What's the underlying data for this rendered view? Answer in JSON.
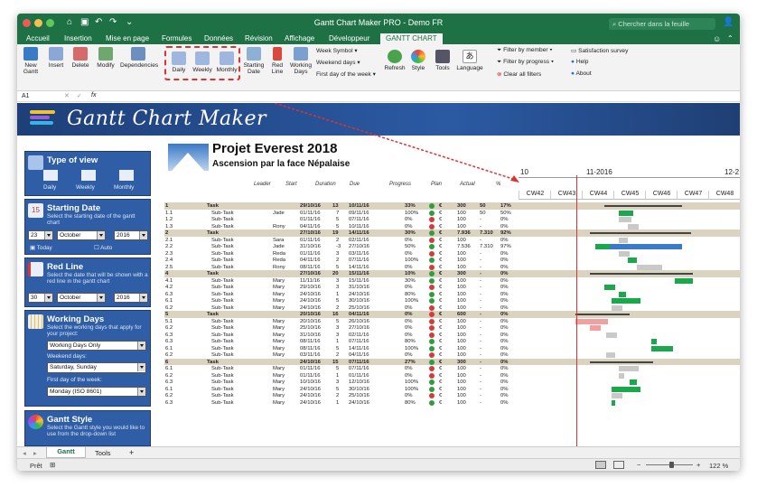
{
  "window": {
    "title": "Gantt Chart Maker PRO - Demo FR",
    "search_placeholder": "Chercher dans la feuille",
    "user_icon": "add-user-icon"
  },
  "menu": [
    "Accueil",
    "Insertion",
    "Mise en page",
    "Formules",
    "Données",
    "Révision",
    "Affichage",
    "Développeur",
    "GANTT CHART"
  ],
  "ribbon": {
    "new_gantt": "New\nGantt",
    "insert": "Insert",
    "delete": "Delete",
    "modify": "Modify",
    "dependencies": "Dependencies",
    "daily": "Daily",
    "weekly": "Weekly",
    "monthly": "Monthly",
    "starting_date": "Starting\nDate",
    "red_line": "Red\nLine",
    "working_days": "Working\nDays",
    "week_symbol": "Week Symbol",
    "weekend_days": "Weekend days",
    "first_day": "First day of the week",
    "refresh": "Refresh",
    "style": "Style",
    "tools": "Tools",
    "language": "Language",
    "filter_member": "Filter by member",
    "filter_progress": "Filter by progress",
    "clear_filters": "Clear all filters",
    "satisfaction": "Satisfaction survey",
    "help": "Help",
    "about": "About"
  },
  "formula": {
    "cell": "A1",
    "fx": "fx"
  },
  "banner": {
    "text": "Gantt Chart Maker"
  },
  "side": {
    "type_title": "Type of view",
    "daily": "Daily",
    "weekly": "Weekly",
    "monthly": "Monthly",
    "start_title": "Starting Date",
    "start_desc": "Select the starting date of the gantt chart",
    "start_day": "23",
    "start_month": "October",
    "start_year": "2016",
    "today": "Today",
    "auto": "Auto",
    "red_title": "Red Line",
    "red_desc": "Select the date that will be shown with a red line in the gantt chart",
    "red_day": "30",
    "red_month": "October",
    "red_year": "2016",
    "work_title": "Working Days",
    "work_desc": "Select the working days that apply for your project:",
    "work_sel": "Working Days Only",
    "weekend_lab": "Weekend days:",
    "weekend_sel": "Saturday, Sunday",
    "first_lab": "First day of the week:",
    "first_sel": "Monday (ISO 8601)",
    "style_title": "Gantt Style",
    "style_desc": "Select the Gantt style you would like to use from the drop-down list"
  },
  "project": {
    "title": "Projet Everest 2018",
    "subtitle": "Ascension par la face Népalaise"
  },
  "columns": [
    "Leader",
    "Start",
    "Duration",
    "Due",
    "Progress",
    "Plan",
    "Actual",
    "%"
  ],
  "timeline": {
    "months": [
      "10",
      "11-2016",
      "12-2"
    ],
    "weeks": [
      "CW42",
      "CW43",
      "CW44",
      "CW45",
      "CW46",
      "CW47",
      "CW48"
    ]
  },
  "rows": [
    {
      "id": "1",
      "name": "Task",
      "leader": "",
      "start": "29/10/16",
      "dur": "13",
      "due": "10/11/16",
      "prog": "33%",
      "dot": "#2e9e3c",
      "plan": "300",
      "actual": "50",
      "pct": "17%",
      "t": 1
    },
    {
      "id": "1.1",
      "name": "Sub-Task",
      "leader": "Jade",
      "start": "01/11/16",
      "dur": "7",
      "due": "09/11/16",
      "prog": "100%",
      "dot": "#2e9e3c",
      "plan": "100",
      "actual": "50",
      "pct": "50%"
    },
    {
      "id": "1.2",
      "name": "Sub-Task",
      "leader": "",
      "start": "01/11/16",
      "dur": "5",
      "due": "07/11/16",
      "prog": "0%",
      "dot": "#d23c3c",
      "plan": "100",
      "actual": "-",
      "pct": "0%"
    },
    {
      "id": "1.3",
      "name": "Sub-Task",
      "leader": "Rony",
      "start": "04/11/16",
      "dur": "5",
      "due": "10/11/16",
      "prog": "0%",
      "dot": "#d23c3c",
      "plan": "100",
      "actual": "-",
      "pct": "0%"
    },
    {
      "id": "2",
      "name": "Task",
      "leader": "",
      "start": "27/10/16",
      "dur": "19",
      "due": "14/11/16",
      "prog": "30%",
      "dot": "#2e9e3c",
      "plan": "7.936",
      "actual": "7.310",
      "pct": "92%",
      "t": 1
    },
    {
      "id": "2.1",
      "name": "Sub-Task",
      "leader": "Sara",
      "start": "01/11/16",
      "dur": "2",
      "due": "02/11/16",
      "prog": "0%",
      "dot": "#d23c3c",
      "plan": "100",
      "actual": "-",
      "pct": "0%"
    },
    {
      "id": "2.2",
      "name": "Sub-Task",
      "leader": "Jade",
      "start": "31/10/16",
      "dur": "-3",
      "due": "27/10/16",
      "prog": "50%",
      "dot": "#2e9e3c",
      "plan": "7.536",
      "actual": "7.310",
      "pct": "97%"
    },
    {
      "id": "2.3",
      "name": "Sub-Task",
      "leader": "Reda",
      "start": "01/11/16",
      "dur": "3",
      "due": "03/11/16",
      "prog": "0%",
      "dot": "#d23c3c",
      "plan": "100",
      "actual": "-",
      "pct": "0%"
    },
    {
      "id": "2.4",
      "name": "Sub-Task",
      "leader": "Reda",
      "start": "04/11/16",
      "dur": "2",
      "due": "07/11/16",
      "prog": "100%",
      "dot": "#2e9e3c",
      "plan": "100",
      "actual": "-",
      "pct": "0%"
    },
    {
      "id": "2.5",
      "name": "Sub-Task",
      "leader": "Rony",
      "start": "08/11/16",
      "dur": "5",
      "due": "14/11/16",
      "prog": "0%",
      "dot": "#d23c3c",
      "plan": "100",
      "actual": "-",
      "pct": "0%"
    },
    {
      "id": "4",
      "name": "Task",
      "leader": "",
      "start": "27/10/16",
      "dur": "20",
      "due": "15/11/16",
      "prog": "10%",
      "dot": "#2e9e3c",
      "plan": "300",
      "actual": "-",
      "pct": "0%",
      "t": 1
    },
    {
      "id": "4.1",
      "name": "Sub-Task",
      "leader": "Mary",
      "start": "11/11/16",
      "dur": "3",
      "due": "15/11/16",
      "prog": "30%",
      "dot": "#2e9e3c",
      "plan": "100",
      "actual": "-",
      "pct": "0%"
    },
    {
      "id": "4.2",
      "name": "Sub-Task",
      "leader": "Mary",
      "start": "29/10/16",
      "dur": "3",
      "due": "31/10/16",
      "prog": "0%",
      "dot": "#d23c3c",
      "plan": "100",
      "actual": "-",
      "pct": "0%"
    },
    {
      "id": "6.3",
      "name": "Sub-Task",
      "leader": "Mary",
      "start": "24/10/16",
      "dur": "1",
      "due": "24/10/16",
      "prog": "80%",
      "dot": "#2e9e3c",
      "plan": "100",
      "actual": "-",
      "pct": "0%"
    },
    {
      "id": "6.1",
      "name": "Sub-Task",
      "leader": "Mary",
      "start": "24/10/16",
      "dur": "5",
      "due": "30/10/16",
      "prog": "100%",
      "dot": "#2e9e3c",
      "plan": "100",
      "actual": "-",
      "pct": "0%"
    },
    {
      "id": "6.2",
      "name": "Sub-Task",
      "leader": "Mary",
      "start": "24/10/16",
      "dur": "2",
      "due": "25/10/16",
      "prog": "0%",
      "dot": "#d23c3c",
      "plan": "100",
      "actual": "-",
      "pct": "0%"
    },
    {
      "id": "5",
      "name": "Task",
      "leader": "",
      "start": "20/10/16",
      "dur": "16",
      "due": "04/11/16",
      "prog": "0%",
      "dot": "#d23c3c",
      "plan": "600",
      "actual": "-",
      "pct": "0%",
      "t": 1
    },
    {
      "id": "5.1",
      "name": "Sub-Task",
      "leader": "Mary",
      "start": "20/10/16",
      "dur": "5",
      "due": "26/10/16",
      "prog": "0%",
      "dot": "#d23c3c",
      "plan": "100",
      "actual": "-",
      "pct": "0%"
    },
    {
      "id": "6.2",
      "name": "Sub-Task",
      "leader": "Mary",
      "start": "25/10/16",
      "dur": "3",
      "due": "27/10/16",
      "prog": "0%",
      "dot": "#d23c3c",
      "plan": "100",
      "actual": "-",
      "pct": "0%"
    },
    {
      "id": "6.3",
      "name": "Sub-Task",
      "leader": "Mary",
      "start": "31/10/16",
      "dur": "3",
      "due": "02/11/16",
      "prog": "0%",
      "dot": "#d23c3c",
      "plan": "100",
      "actual": "-",
      "pct": "0%"
    },
    {
      "id": "6.3",
      "name": "Sub-Task",
      "leader": "Mary",
      "start": "08/11/16",
      "dur": "1",
      "due": "07/11/16",
      "prog": "80%",
      "dot": "#2e9e3c",
      "plan": "100",
      "actual": "-",
      "pct": "0%"
    },
    {
      "id": "6.1",
      "name": "Sub-Task",
      "leader": "Mary",
      "start": "08/11/16",
      "dur": "5",
      "due": "14/11/16",
      "prog": "100%",
      "dot": "#2e9e3c",
      "plan": "100",
      "actual": "-",
      "pct": "0%"
    },
    {
      "id": "6.2",
      "name": "Sub-Task",
      "leader": "Mary",
      "start": "03/11/16",
      "dur": "2",
      "due": "04/11/16",
      "prog": "0%",
      "dot": "#d23c3c",
      "plan": "100",
      "actual": "-",
      "pct": "0%"
    },
    {
      "id": "6",
      "name": "Task",
      "leader": "",
      "start": "24/10/16",
      "dur": "15",
      "due": "07/11/16",
      "prog": "27%",
      "dot": "#2e9e3c",
      "plan": "300",
      "actual": "-",
      "pct": "0%",
      "t": 1
    },
    {
      "id": "6.1",
      "name": "Sub-Task",
      "leader": "Mary",
      "start": "01/11/16",
      "dur": "5",
      "due": "07/11/16",
      "prog": "0%",
      "dot": "#d23c3c",
      "plan": "100",
      "actual": "-",
      "pct": "0%"
    },
    {
      "id": "6.2",
      "name": "Sub-Task",
      "leader": "Mary",
      "start": "01/11/16",
      "dur": "1",
      "due": "01/11/16",
      "prog": "0%",
      "dot": "#d23c3c",
      "plan": "100",
      "actual": "-",
      "pct": "0%"
    },
    {
      "id": "6.3",
      "name": "Sub-Task",
      "leader": "Mary",
      "start": "10/10/16",
      "dur": "3",
      "due": "12/10/16",
      "prog": "100%",
      "dot": "#2e9e3c",
      "plan": "100",
      "actual": "-",
      "pct": "0%"
    },
    {
      "id": "6.1",
      "name": "Sub-Task",
      "leader": "Mary",
      "start": "24/10/16",
      "dur": "5",
      "due": "30/10/16",
      "prog": "100%",
      "dot": "#2e9e3c",
      "plan": "100",
      "actual": "-",
      "pct": "0%"
    },
    {
      "id": "6.2",
      "name": "Sub-Task",
      "leader": "Mary",
      "start": "24/10/16",
      "dur": "2",
      "due": "25/10/16",
      "prog": "0%",
      "dot": "#d23c3c",
      "plan": "100",
      "actual": "-",
      "pct": "0%"
    },
    {
      "id": "6.3",
      "name": "Sub-Task",
      "leader": "Mary",
      "start": "24/10/16",
      "dur": "1",
      "due": "24/10/16",
      "prog": "80%",
      "dot": "#2e9e3c",
      "plan": "100",
      "actual": "-",
      "pct": "0%"
    }
  ],
  "tabs": {
    "gantt": "Gantt",
    "tools": "Tools",
    "add": "+"
  },
  "status": {
    "ready": "Prêt",
    "zoom": "122 %"
  }
}
